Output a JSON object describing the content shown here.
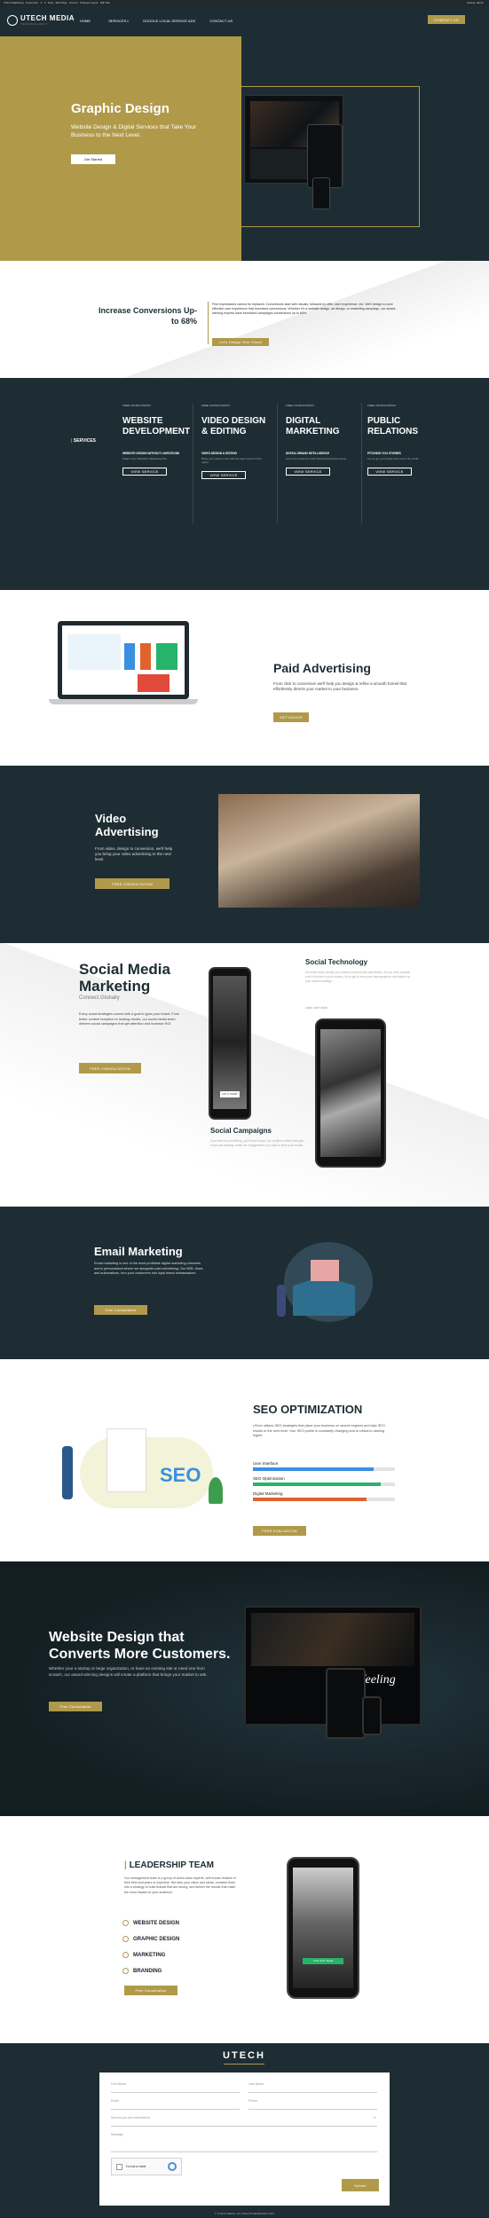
{
  "colors": {
    "gold": "#b09a4a",
    "navy": "#1d2d33",
    "dark": "#111c21"
  },
  "adminbar": {
    "items": [
      "UTech Marketing",
      "Customize",
      "4",
      "0",
      "New",
      "Edit Page",
      "Smush",
      "Change Layout",
      "Edit Site"
    ],
    "right": "Howdy, admin"
  },
  "nav": {
    "logo": "UTECH MEDIA",
    "logo_sub": "TECHNOLOGY",
    "links": [
      "HOME",
      "SERVICES",
      "GOOGLE LOCAL SERVICE ADS",
      "CONTACT US"
    ],
    "cta": "CONTACT US"
  },
  "hero": {
    "title": "Graphic Design",
    "subtitle": "Website Design & Digital Services that Take Your Business to the Next Level.",
    "button": "Get Started"
  },
  "conversions": {
    "title": "Increase Conversions Up-to 68%",
    "body": "First impressions cannot be replaced.  Conversions start with visuals, followed by offer, user experience, etc. We'll design a more effective user experience that increases conversions.  Whether it's a website design, ad design, or marketing campaign, our award-winning experts have increased campaigns conversions up to 68%.",
    "button": "Let's Design Your Visual"
  },
  "services": {
    "label": "SERVICES",
    "columns": [
      {
        "tag": "FREE CONSULTATION",
        "title": "WEBSITE DEVELOPMENT",
        "sub": "WEBSITE DESIGN WITHOUT LIMITATIONS",
        "desc": "What's Your Website's Marketing ROI",
        "button": "VIEW SERVICE"
      },
      {
        "tag": "FREE CONSULTATION",
        "title": "VIDEO DESIGN & EDITING",
        "sub": "VIDEO DESIGN & EDITING",
        "desc": "Bring your videos to life with the best content in the region",
        "button": "VIEW SERVICE"
      },
      {
        "tag": "FREE CONSULTATION",
        "title": "DIGITAL MARKETING",
        "sub": "DIGITAL BRAND INTELLIGENCE",
        "desc": "Get more customers with Optimized ad placements",
        "button": "VIEW SERVICE"
      },
      {
        "tag": "FREE CONSULTATION",
        "title": "PUBLIC RELATIONS",
        "sub": "PITCHING YOU STORIES",
        "desc": "Let us get your brand story out to the world",
        "button": "VIEW SERVICE"
      }
    ]
  },
  "paid": {
    "title": "Paid Advertising",
    "body": "From click to conversion we'll help you design & refine a smooth funnel that effortlessly directs your market to your business.",
    "button": "GET ADVICE"
  },
  "video": {
    "title": "Video Advertising",
    "body": "From video, design to conversion, we'll help you bring your video advertising to the next level.",
    "button": "FREE CONSULTATION"
  },
  "social": {
    "title": "Social Media Marketing",
    "tagline": "Connect Globally",
    "body": "Every social strategies comes with a goal to grow your brand. From better content inception to landing results, our social media team delivers social campaigns that get attention and increase ROI.",
    "button": "FREE CONSULTATION",
    "tech_title": "Social Technology",
    "tech_body": "Our team helps identify your brands social media optimization. As you work towards a set of trends in your industry, let us get to know your demographics and tighten up your content strategy.",
    "tech_link": "Learn more about",
    "phone_btn": "LET'S START",
    "campaigns_title": "Social Campaigns",
    "campaigns_body": "If you don't try something, you'll never know. Our creative content and paid social ads strategy create the engagements you want to drive your results."
  },
  "email": {
    "title": "Email Marketing",
    "body": "Email marketing is one of the most profitable digital marketing channels and is personalized where we alongside paid advertising. Our B2B, flows and automations, turn your customers into loyal brand ambassadors.",
    "button": "Free Consultation"
  },
  "seo": {
    "title": "SEO OPTIMIZATION",
    "body": "UTech utilizes SEO strategies that place your business on search engines and take SEO results to the next level. Your SEO profile is constantly changing and is critical to ranking higher.",
    "bars": [
      {
        "label": "User Interface",
        "value": 0.85,
        "color": "#3b8fe0"
      },
      {
        "label": "SEO Optimization",
        "value": 0.9,
        "color": "#27b36a"
      },
      {
        "label": "Digital Marketing",
        "value": 0.8,
        "color": "#e0632e"
      }
    ],
    "button": "FREE EVALUATION",
    "logo_text": "SEO"
  },
  "website": {
    "title": "Website Design that Converts More Customers.",
    "body": "Whether your a startup or large organization, or have an existing site or need one from scratch, our award-winning designs will create a platform that brings your market to ask.",
    "button": "Free Consultation",
    "screen_text": "the feeling"
  },
  "leadership": {
    "title": "LEADERSHIP TEAM",
    "body": "Our management team is a group of world-class experts, well known leaders in their field and years of expertise. We take your vision and ideas, combine them into a strategy to build brands that are strong, and deliver the results that make the most impact on your audience.",
    "items": [
      "WEBSITE DESIGN",
      "GRAPHIC DESIGN",
      "MARKETING",
      "BRANDING"
    ],
    "button": "Free Consultation",
    "phone_btn": "JOIN OUR TEAM"
  },
  "contact": {
    "logo": "UTECH",
    "fields": {
      "name": "First Name",
      "last": "Last Name",
      "email": "Email",
      "phone": "Phone",
      "select": "Service you are interested in",
      "message": "Message"
    },
    "captcha": "I'm not a robot",
    "button": "Submit"
  },
  "footer": {
    "copyright": "© UTECH MEDIA. ALL RIGHTS RESERVED 2021"
  }
}
